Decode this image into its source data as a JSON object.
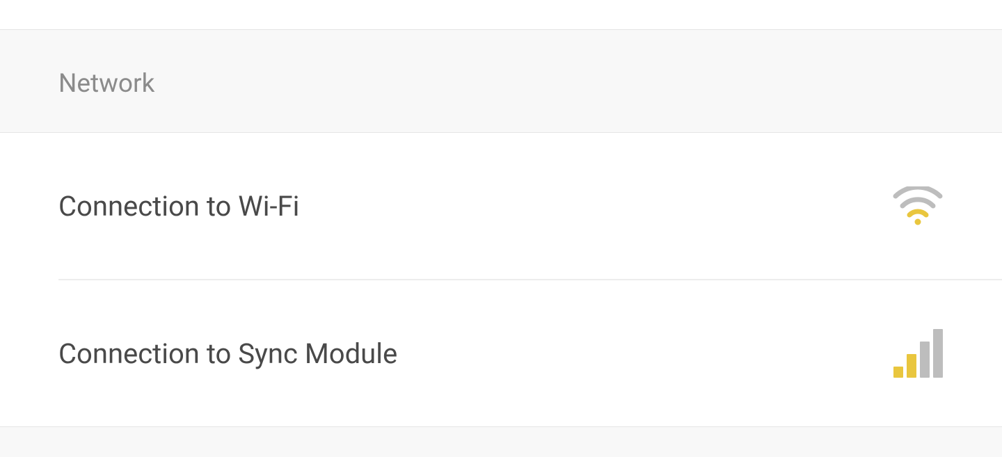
{
  "section": {
    "title": "Network"
  },
  "items": {
    "wifi": {
      "label": "Connection to Wi-Fi",
      "icon": "wifi-icon",
      "signal_level": 1
    },
    "sync_module": {
      "label": "Connection to Sync Module",
      "icon": "signal-bars-icon",
      "signal_level": 2
    }
  },
  "colors": {
    "accent": "#e9c63e",
    "muted": "#bdbdbd",
    "text_primary": "#494949",
    "text_secondary": "#8b8b8b"
  }
}
